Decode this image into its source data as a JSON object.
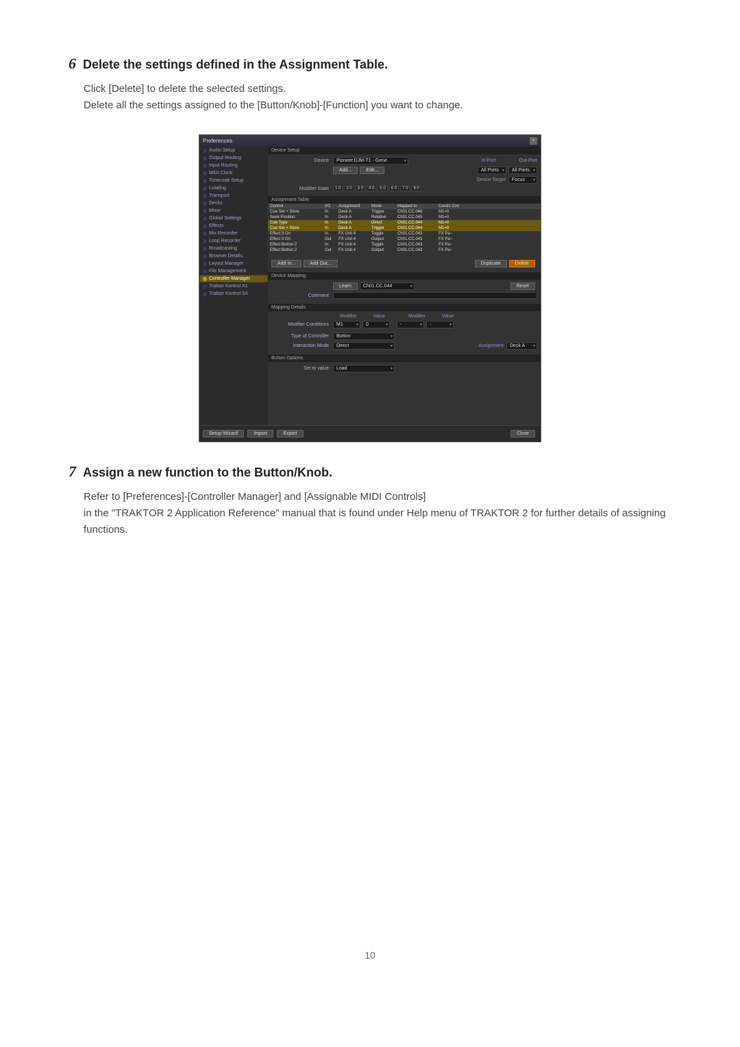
{
  "step6": {
    "number": "6",
    "title": "Delete the settings defined in the Assignment Table.",
    "line1": "Click [Delete] to delete the selected settings.",
    "line2": "Delete all the settings assigned to the [Button/Knob]-[Function] you want to change."
  },
  "step7": {
    "number": "7",
    "title": "Assign a new function to the Button/Knob.",
    "line1": "Refer to [Preferences]-[Controller Manager] and [Assignable MIDI Controls]",
    "line2": "in the \"TRAKTOR 2 Application Reference\" manual that is found under  Help menu of TRAKTOR 2 for further details of assigning functions."
  },
  "pref": {
    "title": "Preferences",
    "close_x": "×",
    "sidebar": [
      "Audio Setup",
      "Output Routing",
      "Input Routing",
      "MIDI Clock",
      "Timecode Setup",
      "Loading",
      "Transport",
      "Decks",
      "Mixer",
      "Global Settings",
      "Effects",
      "Mix Recorder",
      "Loop Recorder",
      "Broadcasting",
      "Browser Details",
      "Layout Manager",
      "File Management",
      "Controller Manager",
      "Traktor Kontrol X1",
      "Traktor Kontrol S4"
    ],
    "sidebar_sel_index": 17,
    "device_setup": {
      "header": "Device Setup",
      "device_label": "Device",
      "device_value": "Pioneer.DJM-T1 - Gene",
      "in_port_label": "In-Port",
      "in_port_value": "All Ports",
      "out_port_label": "Out-Port",
      "out_port_value": "All Ports",
      "add": "Add...",
      "edit": "Edit...",
      "device_target_label": "Device Target",
      "device_target_value": "Focus",
      "modifier_state_label": "Modifier State",
      "mods": [
        "1 0",
        "2 0",
        "3 0",
        "4 0",
        "5 0",
        "6 0",
        "7 0",
        "8 0"
      ]
    },
    "assignment_table": {
      "header": "Assignment Table",
      "cols": {
        "control": "Control",
        "io": "I/O",
        "assignment": "Assignment",
        "mode": "Mode",
        "mapped": "Mapped to",
        "cond": "Cond1 Con"
      },
      "rows": [
        {
          "control": "Cue Set + Store",
          "io": "In",
          "assignment": "Deck A",
          "mode": "Trigger",
          "mapped": "Ch01.CC.046",
          "cond": "M1=0",
          "sel": false
        },
        {
          "control": "Seek Position",
          "io": "In",
          "assignment": "Deck A",
          "mode": "Relative",
          "mapped": "Ch01.CC.045",
          "cond": "M1=0",
          "sel": false
        },
        {
          "control": "Cue Type",
          "io": "In",
          "assignment": "Deck A",
          "mode": "Direct",
          "mapped": "Ch01.CC.044",
          "cond": "M1=0",
          "sel": true
        },
        {
          "control": "Cue Set + Store",
          "io": "In",
          "assignment": "Deck A",
          "mode": "Trigger",
          "mapped": "Ch01.CC.044",
          "cond": "M1=0",
          "sel": true
        },
        {
          "control": "Effect 3 On",
          "io": "In",
          "assignment": "FX Unit 4",
          "mode": "Toggle",
          "mapped": "Ch01.CC.043",
          "cond": "FX Pa~",
          "sel": false
        },
        {
          "control": "Effect 3 On",
          "io": "Out",
          "assignment": "FX Unit 4",
          "mode": "Output",
          "mapped": "Ch01.CC.043",
          "cond": "FX Pa~",
          "sel": false
        },
        {
          "control": "Effect Button 2",
          "io": "In",
          "assignment": "FX Unit 4",
          "mode": "Toggle",
          "mapped": "Ch01.CC.043",
          "cond": "FX Pa~",
          "sel": false
        },
        {
          "control": "Effect Button 2",
          "io": "Out",
          "assignment": "FX Unit 4",
          "mode": "Output",
          "mapped": "Ch01.CC.043",
          "cond": "FX Pa~",
          "sel": false
        }
      ],
      "add_in": "Add In...",
      "add_out": "Add Out...",
      "duplicate": "Duplicate",
      "delete": "Delete"
    },
    "device_mapping": {
      "header": "Device Mapping",
      "learn": "Learn",
      "learn_value": "Ch01.CC.044",
      "reset": "Reset",
      "comment_label": "Comment"
    },
    "mapping_details": {
      "header": "Mapping Details",
      "modifier": "Modifier",
      "value": "Value",
      "modifier2": "Modifier",
      "value2": "Value",
      "modifier_conditions_label": "Modifier Conditions",
      "m1": "M1",
      "m1v": "0",
      "type_label": "Type of Controller",
      "type_value": "Button",
      "interaction_label": "Interaction Mode",
      "interaction_value": "Direct",
      "assignment_label": "Assignment",
      "assignment_value": "Deck A"
    },
    "button_options": {
      "header": "Button Options",
      "set_value_label": "Set to value",
      "set_value": "Load"
    },
    "footer": {
      "setup_wizard": "Setup Wizard",
      "import": "Import",
      "export": "Export",
      "close": "Close"
    }
  },
  "page_number": "10"
}
